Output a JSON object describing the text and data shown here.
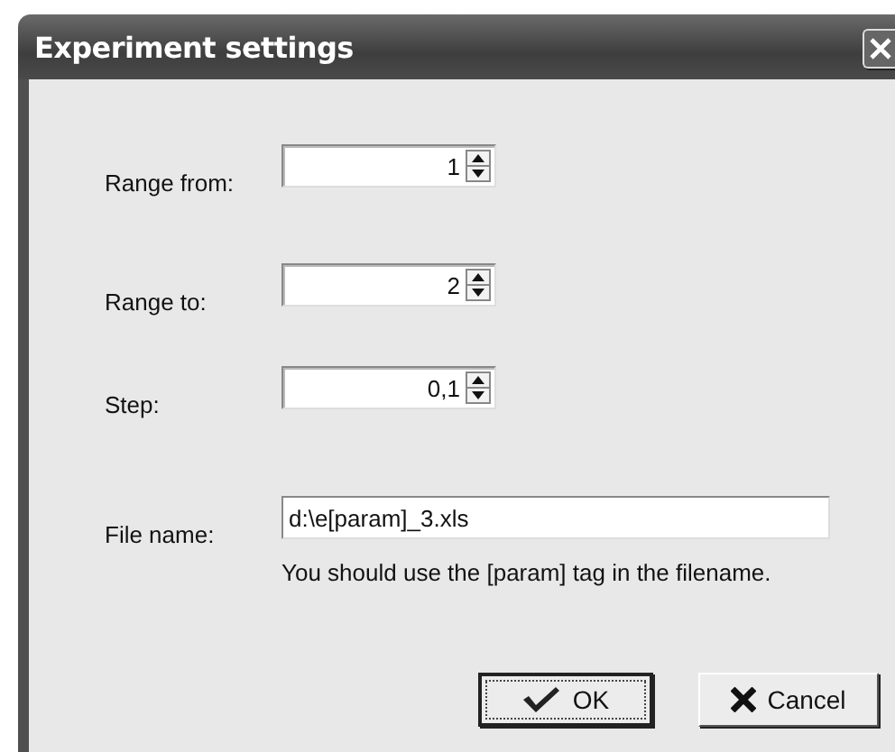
{
  "window": {
    "title": "Experiment settings"
  },
  "spin_fields": [
    {
      "label": "Range from:",
      "value": "1"
    },
    {
      "label": "Range to:",
      "value": "2"
    },
    {
      "label": "Step:",
      "value": "0,1"
    }
  ],
  "file_name": {
    "label": "File name:",
    "value": "d:\\e[param]_3.xls",
    "hint": "You should use the [param] tag in the filename."
  },
  "buttons": [
    {
      "kind": "ok",
      "label": "OK",
      "focused": true
    },
    {
      "kind": "cancel",
      "label": "Cancel",
      "focused": false
    }
  ]
}
